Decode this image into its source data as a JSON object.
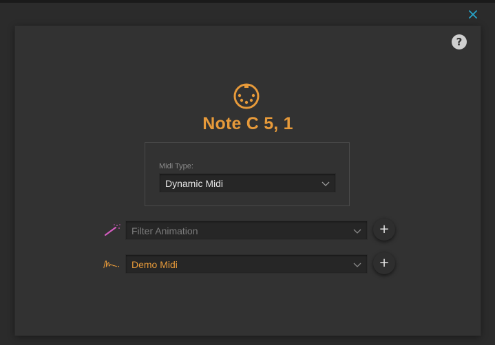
{
  "window": {
    "close_icon": "close-icon",
    "help_label": "?"
  },
  "header": {
    "icon": "midi-din-icon",
    "title": "Note C 5, 1"
  },
  "midi_type": {
    "label": "Midi Type:",
    "value": "Dynamic Midi"
  },
  "rows": [
    {
      "icon": "magic-wand-icon",
      "value": "Filter Animation",
      "is_placeholder": true,
      "add_label": "+"
    },
    {
      "icon": "signature-icon",
      "value": "Demo Midi",
      "is_placeholder": false,
      "add_label": "+"
    }
  ],
  "colors": {
    "accent": "#e79a3a",
    "background": "#2b2b2b",
    "panel": "#323232",
    "close": "#27a3c8",
    "wand": "#d45cc0"
  }
}
